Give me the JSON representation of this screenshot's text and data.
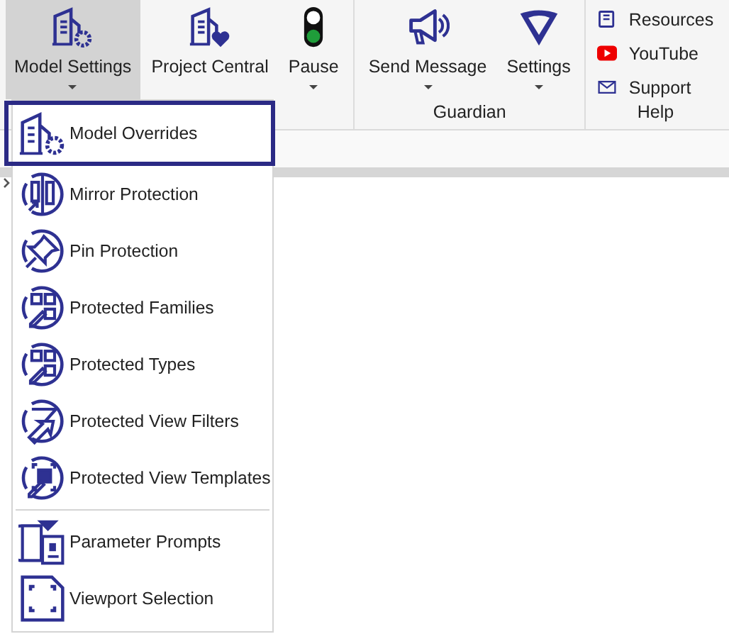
{
  "ribbon": {
    "groups": [
      {
        "buttons": [
          {
            "label": "Model Settings",
            "selected": true,
            "dropdown": true
          },
          {
            "label": "Project Central",
            "selected": false,
            "dropdown": false
          },
          {
            "label": "Pause",
            "selected": false,
            "dropdown": true
          }
        ]
      },
      {
        "label": "Guardian",
        "buttons": [
          {
            "label": "Send Message",
            "selected": false,
            "dropdown": true
          },
          {
            "label": "Settings",
            "selected": false,
            "dropdown": true
          }
        ]
      }
    ],
    "help": {
      "label": "Help",
      "links": [
        "Resources",
        "YouTube",
        "Support"
      ]
    }
  },
  "menu": {
    "items": [
      {
        "label": "Model Overrides",
        "selected": true,
        "separator_before": false
      },
      {
        "label": "Mirror Protection",
        "selected": false,
        "separator_before": false
      },
      {
        "label": "Pin Protection",
        "selected": false,
        "separator_before": false
      },
      {
        "label": "Protected Families",
        "selected": false,
        "separator_before": false
      },
      {
        "label": "Protected Types",
        "selected": false,
        "separator_before": false
      },
      {
        "label": "Protected View Filters",
        "selected": false,
        "separator_before": false
      },
      {
        "label": "Protected View Templates",
        "selected": false,
        "separator_before": false
      },
      {
        "label": "Parameter Prompts",
        "selected": false,
        "separator_before": true
      },
      {
        "label": "Viewport Selection",
        "selected": false,
        "separator_before": false
      }
    ]
  }
}
